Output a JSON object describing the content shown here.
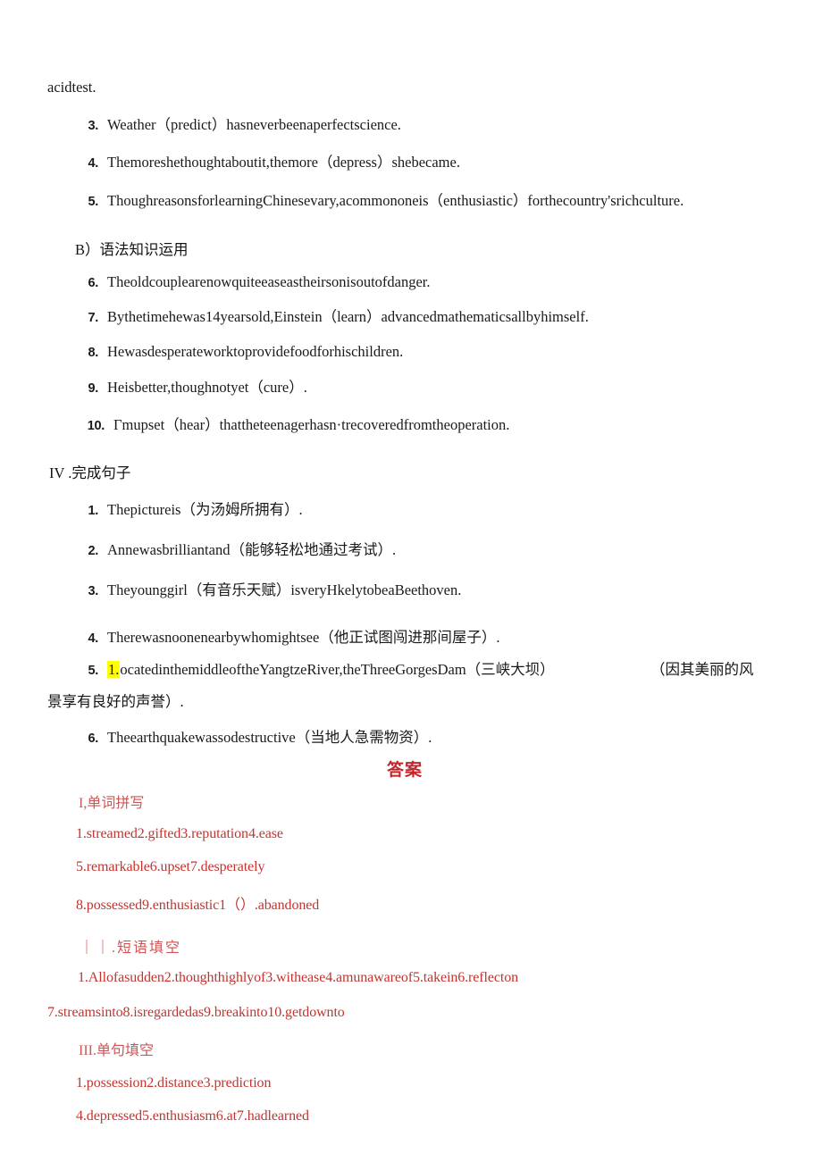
{
  "document": {
    "intro_fragment": "acidtest.",
    "section_a_items": [
      {
        "num": "3.",
        "text": "Weather（predict）hasneverbeenaperfectscience."
      },
      {
        "num": "4.",
        "text": "Themoreshethoughtaboutit,themore（depress）shebecame."
      },
      {
        "num": "5.",
        "text": "ThoughreasonsforlearningChinesevary,acommononeis（enthusiastic）forthecountry'srichculture."
      }
    ],
    "section_b": {
      "heading": "B）语法知识运用",
      "items": [
        {
          "num": "6.",
          "text": "Theoldcouplearenowquiteeaseastheirsonisoutofdanger."
        },
        {
          "num": "7.",
          "text": "Bythetimehewas14yearsold,Einstein（learn）advancedmathematicsallbyhimself."
        },
        {
          "num": "8.",
          "text": "Hewasdesperateworktoprovidefoodforhischildren."
        },
        {
          "num": "9.",
          "text": "Heisbetter,thoughnotyet（cure）."
        },
        {
          "num": "10.",
          "text": "Γmupset（hear）thattheteenagerhasn·trecoveredfromtheoperation."
        }
      ]
    },
    "section_iv": {
      "heading": "IV .完成句子",
      "items": [
        {
          "num": "1.",
          "text": "Thepictureis（为汤姆所拥有）."
        },
        {
          "num": "2.",
          "text": "Annewasbrilliantand（能够轻松地通过考试）."
        },
        {
          "num": "3.",
          "text": "Theyounggirl（有音乐天赋）isveryHkelytobeaBeethoven."
        },
        {
          "num": "4.",
          "text": "Therewasnoonenearbywhomightsee（他正试图闯进那间屋子）."
        },
        {
          "num": "5.",
          "highlight": "1.",
          "text_after_highlight": "ocatedinthemiddleoftheYangtzeRiver,theThreeGorgesDam（三峡大坝）",
          "tail": "（因其美丽的风",
          "wrap": "景享有良好的声誉）."
        },
        {
          "num": "6.",
          "text": "Theearthquakewassodestructive（当地人急需物资）."
        }
      ]
    },
    "answers": {
      "title": "答案",
      "sections": [
        {
          "heading": "I,单词拼写",
          "lines": [
            "1.streamed2.gifted3.reputation4.ease",
            "5.remarkable6.upset7.desperately",
            "8.possessed9.enthusiastic1（）.abandoned"
          ]
        },
        {
          "heading": "｜｜.短语填空",
          "lines": [
            "1.Allofasudden2.thoughthighlyof3.withease4.amunawareof5.takein6.reflecton",
            "7.streamsinto8.isregardedas9.breakinto10.getdownto"
          ]
        },
        {
          "heading": "III.单句填空",
          "lines": [
            "1.possession2.distance3.prediction",
            "4.depressed5.enthusiasm6.at7.hadlearned"
          ]
        }
      ]
    },
    "colors": {
      "answer_title_red": "#c0272d",
      "answer_text_red": "#c3332f",
      "answer_heading_red": "#cc5555",
      "highlight_yellow": "#ffff00",
      "body_text": "#141414"
    }
  }
}
